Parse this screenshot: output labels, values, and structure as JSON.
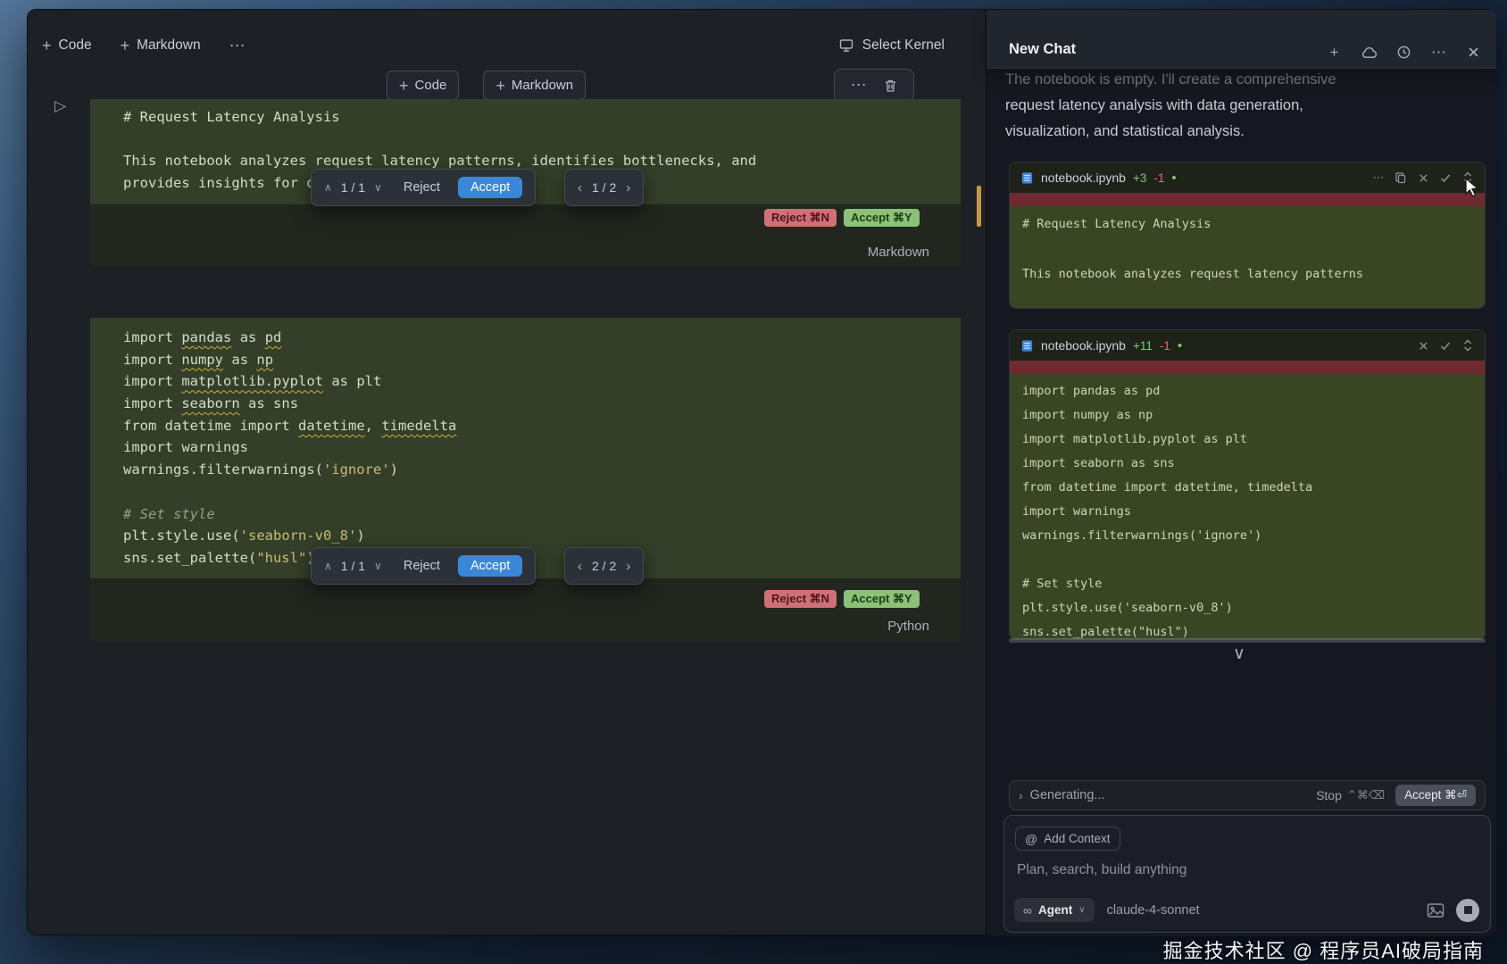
{
  "editor": {
    "toolbar": {
      "code": "Code",
      "markdown": "Markdown",
      "select_kernel": "Select Kernel"
    },
    "insert": {
      "code": "Code",
      "markdown": "Markdown"
    },
    "run_icon": "▷",
    "cells": {
      "markdown": {
        "language": "Markdown",
        "lines": [
          "# Request Latency Analysis",
          "",
          "This notebook analyzes request latency patterns, identifies bottlenecks, and",
          "provides insights for optimization."
        ]
      },
      "python": {
        "language": "Python",
        "lines": [
          [
            [
              "import",
              "k"
            ],
            [
              " ",
              "p"
            ],
            [
              "pandas",
              "u"
            ],
            [
              " ",
              "p"
            ],
            [
              "as",
              "k"
            ],
            [
              " ",
              "p"
            ],
            [
              "pd",
              "u"
            ]
          ],
          [
            [
              "import",
              "k"
            ],
            [
              " ",
              "p"
            ],
            [
              "numpy",
              "u"
            ],
            [
              " ",
              "p"
            ],
            [
              "as",
              "k"
            ],
            [
              " ",
              "p"
            ],
            [
              "np",
              "u"
            ]
          ],
          [
            [
              "import",
              "k"
            ],
            [
              " ",
              "p"
            ],
            [
              "matplotlib.pyplot",
              "u"
            ],
            [
              " ",
              "p"
            ],
            [
              "as",
              "k"
            ],
            [
              " ",
              "p"
            ],
            [
              "plt",
              "p"
            ]
          ],
          [
            [
              "import",
              "k"
            ],
            [
              " ",
              "p"
            ],
            [
              "seaborn",
              "u"
            ],
            [
              " ",
              "p"
            ],
            [
              "as",
              "k"
            ],
            [
              " ",
              "p"
            ],
            [
              "sns",
              "p"
            ]
          ],
          [
            [
              "from",
              "k"
            ],
            [
              " datetime ",
              "p"
            ],
            [
              "import",
              "k"
            ],
            [
              " ",
              "p"
            ],
            [
              "datetime",
              "u"
            ],
            [
              ", ",
              "p"
            ],
            [
              "timedelta",
              "u"
            ]
          ],
          [
            [
              "import",
              "k"
            ],
            [
              " warnings",
              "p"
            ]
          ],
          [
            [
              "warnings.filterwarnings(",
              "p"
            ],
            [
              "'ignore'",
              "s"
            ],
            [
              ")",
              "p"
            ]
          ],
          [],
          [
            [
              "# Set style",
              "c"
            ]
          ],
          [
            [
              "plt.style.use(",
              "p"
            ],
            [
              "'seaborn-v0_8'",
              "s"
            ],
            [
              ")",
              "p"
            ]
          ],
          [
            [
              "sns.set_palette(",
              "p"
            ],
            [
              "\"husl\"",
              "s"
            ],
            [
              ")",
              "p"
            ]
          ]
        ]
      }
    },
    "diffbar": {
      "position": "1 / 1",
      "reject": "Reject",
      "accept": "Accept"
    },
    "pager1": "1 / 2",
    "pager2": "2 / 2",
    "badges": {
      "reject": "Reject ⌘N",
      "accept": "Accept ⌘Y"
    }
  },
  "chat": {
    "title": "New Chat",
    "message": [
      "The notebook is empty. I'll create a comprehensive",
      "request latency analysis with data generation,",
      "visualization, and statistical analysis."
    ],
    "cards": [
      {
        "file": "notebook.ipynb",
        "added": "+3",
        "removed": "-1",
        "lines": [
          "# Request Latency Analysis",
          "",
          "This notebook analyzes request latency patterns"
        ]
      },
      {
        "file": "notebook.ipynb",
        "added": "+11",
        "removed": "-1",
        "lines": [
          "import pandas as pd",
          "import numpy as np",
          "import matplotlib.pyplot as plt",
          "import seaborn as sns",
          "from datetime import datetime, timedelta",
          "import warnings",
          "warnings.filterwarnings('ignore')",
          "",
          "# Set style",
          "plt.style.use('seaborn-v0_8')",
          "sns.set_palette(\"husl\")"
        ]
      }
    ],
    "status": {
      "label": "Generating...",
      "stop": "Stop",
      "stop_keys": "⌃⌘⌫",
      "accept": "Accept ⌘⏎"
    },
    "composer": {
      "context": "Add Context",
      "placeholder": "Plan, search, build anything",
      "mode": "Agent",
      "model": "claude-4-sonnet"
    }
  },
  "watermark": "掘金技术社区 @ 程序员AI破局指南",
  "colors": {
    "accent_blue": "#3a87d8",
    "diff_green": "#333f29",
    "diff_red": "#6d2b2f",
    "badge_reject": "#cf7077",
    "badge_accept": "#8cc178",
    "amber_marker": "#c9973f"
  }
}
